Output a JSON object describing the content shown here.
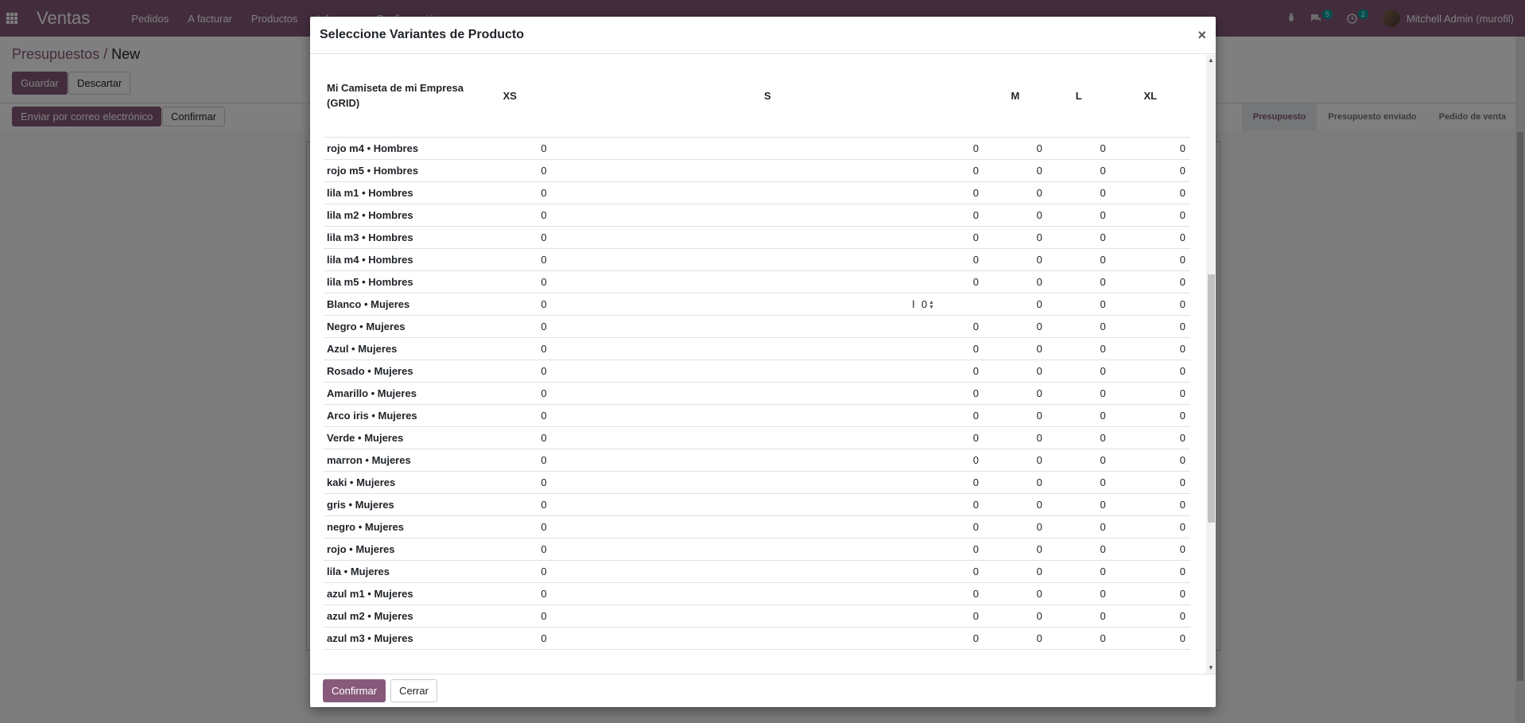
{
  "navbar": {
    "brand": "Ventas",
    "menu": [
      "Pedidos",
      "A facturar",
      "Productos",
      "Informes",
      "Configuración"
    ],
    "chat_count": "5",
    "activity_count": "2",
    "user": "Mitchell Admin (murofil)"
  },
  "control_panel": {
    "breadcrumb_parent": "Presupuestos",
    "breadcrumb_separator": " / ",
    "breadcrumb_current": "New",
    "save_label": "Guardar",
    "discard_label": "Descartar",
    "email_label": "Enviar por correo electrónico",
    "confirm_label": "Confirmar",
    "status_steps": [
      "Presupuesto",
      "Presupuesto enviado",
      "Pedido de venta"
    ]
  },
  "modal": {
    "title": "Seleccione Variantes de Producto",
    "close": "×",
    "confirm_label": "Confirmar",
    "close_label": "Cerrar"
  },
  "grid": {
    "corner_title": "Mi Camiseta de mi Empresa (GRID)",
    "columns": [
      "XS",
      "S",
      "M",
      "L",
      "XL"
    ],
    "rows": [
      {
        "label": "rojo m4 • Hombres",
        "values": [
          "0",
          "0",
          "0",
          "0",
          "0"
        ]
      },
      {
        "label": "rojo m5 • Hombres",
        "values": [
          "0",
          "0",
          "0",
          "0",
          "0"
        ]
      },
      {
        "label": "lila m1 • Hombres",
        "values": [
          "0",
          "0",
          "0",
          "0",
          "0"
        ]
      },
      {
        "label": "lila m2 • Hombres",
        "values": [
          "0",
          "0",
          "0",
          "0",
          "0"
        ]
      },
      {
        "label": "lila m3 • Hombres",
        "values": [
          "0",
          "0",
          "0",
          "0",
          "0"
        ]
      },
      {
        "label": "lila m4 • Hombres",
        "values": [
          "0",
          "0",
          "0",
          "0",
          "0"
        ]
      },
      {
        "label": "lila m5 • Hombres",
        "values": [
          "0",
          "0",
          "0",
          "0",
          "0"
        ]
      },
      {
        "label": "Blanco • Mujeres",
        "values": [
          "0",
          "0",
          "0",
          "0",
          "0"
        ]
      },
      {
        "label": "Negro • Mujeres",
        "values": [
          "0",
          "0",
          "0",
          "0",
          "0"
        ]
      },
      {
        "label": "Azul • Mujeres",
        "values": [
          "0",
          "0",
          "0",
          "0",
          "0"
        ]
      },
      {
        "label": "Rosado • Mujeres",
        "values": [
          "0",
          "0",
          "0",
          "0",
          "0"
        ]
      },
      {
        "label": "Amarillo • Mujeres",
        "values": [
          "0",
          "0",
          "0",
          "0",
          "0"
        ]
      },
      {
        "label": "Arco iris • Mujeres",
        "values": [
          "0",
          "0",
          "0",
          "0",
          "0"
        ]
      },
      {
        "label": "Verde • Mujeres",
        "values": [
          "0",
          "0",
          "0",
          "0",
          "0"
        ]
      },
      {
        "label": "marron • Mujeres",
        "values": [
          "0",
          "0",
          "0",
          "0",
          "0"
        ]
      },
      {
        "label": "kaki • Mujeres",
        "values": [
          "0",
          "0",
          "0",
          "0",
          "0"
        ]
      },
      {
        "label": "gris • Mujeres",
        "values": [
          "0",
          "0",
          "0",
          "0",
          "0"
        ]
      },
      {
        "label": "negro • Mujeres",
        "values": [
          "0",
          "0",
          "0",
          "0",
          "0"
        ]
      },
      {
        "label": "rojo • Mujeres",
        "values": [
          "0",
          "0",
          "0",
          "0",
          "0"
        ]
      },
      {
        "label": "lila • Mujeres",
        "values": [
          "0",
          "0",
          "0",
          "0",
          "0"
        ]
      },
      {
        "label": "azul m1 • Mujeres",
        "values": [
          "0",
          "0",
          "0",
          "0",
          "0"
        ]
      },
      {
        "label": "azul m2 • Mujeres",
        "values": [
          "0",
          "0",
          "0",
          "0",
          "0"
        ]
      },
      {
        "label": "azul m3 • Mujeres",
        "values": [
          "0",
          "0",
          "0",
          "0",
          "0"
        ]
      }
    ]
  },
  "colors": {
    "brand": "#875a7b",
    "badge": "#00a09d"
  }
}
